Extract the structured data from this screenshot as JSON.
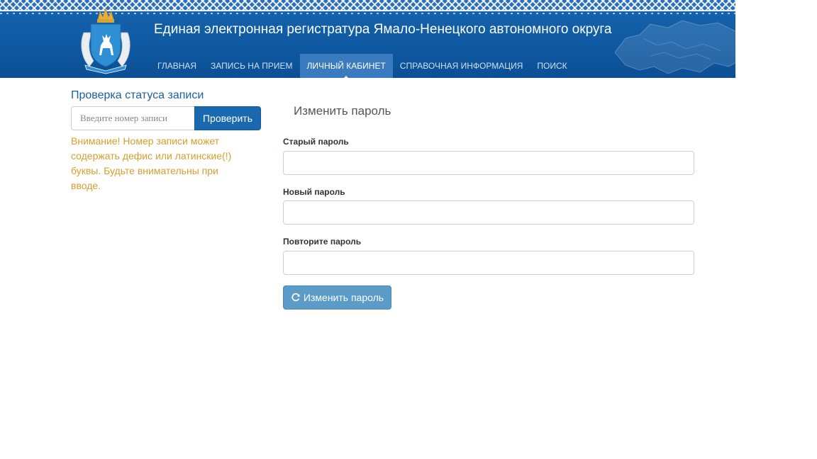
{
  "header": {
    "title": "Единая электронная регистратура Ямало-Ненецкого автономного округа",
    "emblem_icon": "yanao-coat-of-arms-icon",
    "map_icon": "russia-map-icon"
  },
  "nav": {
    "items": [
      {
        "label": "ГЛАВНАЯ",
        "active": false
      },
      {
        "label": "ЗАПИСЬ НА ПРИЕМ",
        "active": false
      },
      {
        "label": "ЛИЧНЫЙ КАБИНЕТ",
        "active": true
      },
      {
        "label": "СПРАВОЧНАЯ ИНФОРМАЦИЯ",
        "active": false
      },
      {
        "label": "ПОИСК",
        "active": false
      }
    ]
  },
  "sidebar": {
    "title": "Проверка статуса записи",
    "input_placeholder": "Введите номер записи",
    "input_value": "",
    "check_button": "Проверить",
    "warning": "Внимание! Номер записи может содержать дефис или латинские(!) буквы. Будьте внимательны при вводе."
  },
  "form": {
    "title": "Изменить пароль",
    "fields": [
      {
        "label": "Старый пароль",
        "value": ""
      },
      {
        "label": "Новый пароль",
        "value": ""
      },
      {
        "label": "Повторите пароль",
        "value": ""
      }
    ],
    "submit_label": "Изменить пароль",
    "submit_icon": "refresh-icon"
  },
  "colors": {
    "header_bg": "#0f5aa3",
    "primary_button": "#1a68ad",
    "submit_button": "#5b9bc7",
    "warning_text": "#d69e2e",
    "sidebar_title": "#1c5fa0"
  }
}
